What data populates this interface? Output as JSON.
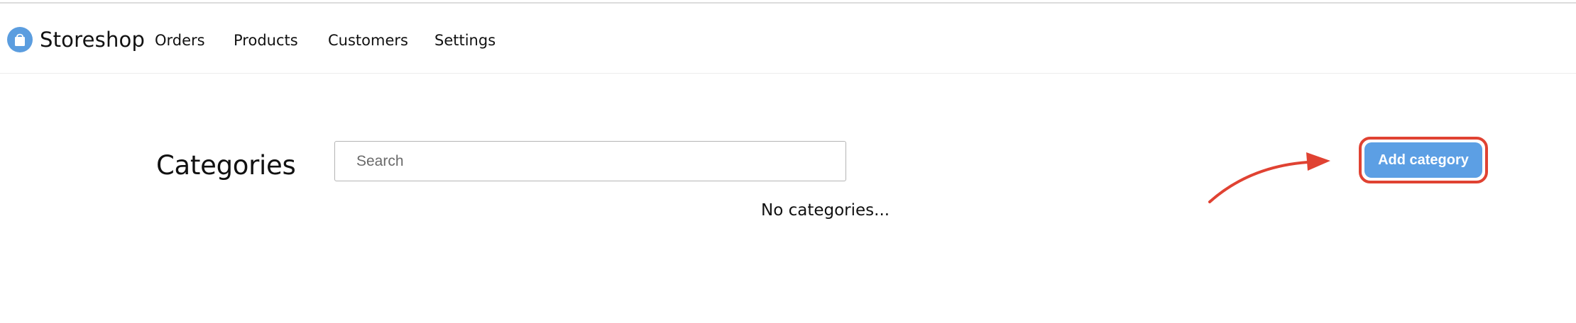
{
  "brand": {
    "name": "Storeshop",
    "logo_icon": "shopping-bag-icon",
    "logo_color": "#5b9ddf"
  },
  "nav": {
    "items": [
      {
        "label": "Orders"
      },
      {
        "label": "Products"
      },
      {
        "label": "Customers"
      },
      {
        "label": "Settings"
      }
    ]
  },
  "main": {
    "title": "Categories",
    "search": {
      "placeholder": "Search",
      "value": ""
    },
    "empty_message": "No categories...",
    "add_button": {
      "label": "Add category",
      "color": "#5c9fe4"
    }
  },
  "annotation": {
    "highlight_color": "#e04232",
    "target": "Add category"
  }
}
